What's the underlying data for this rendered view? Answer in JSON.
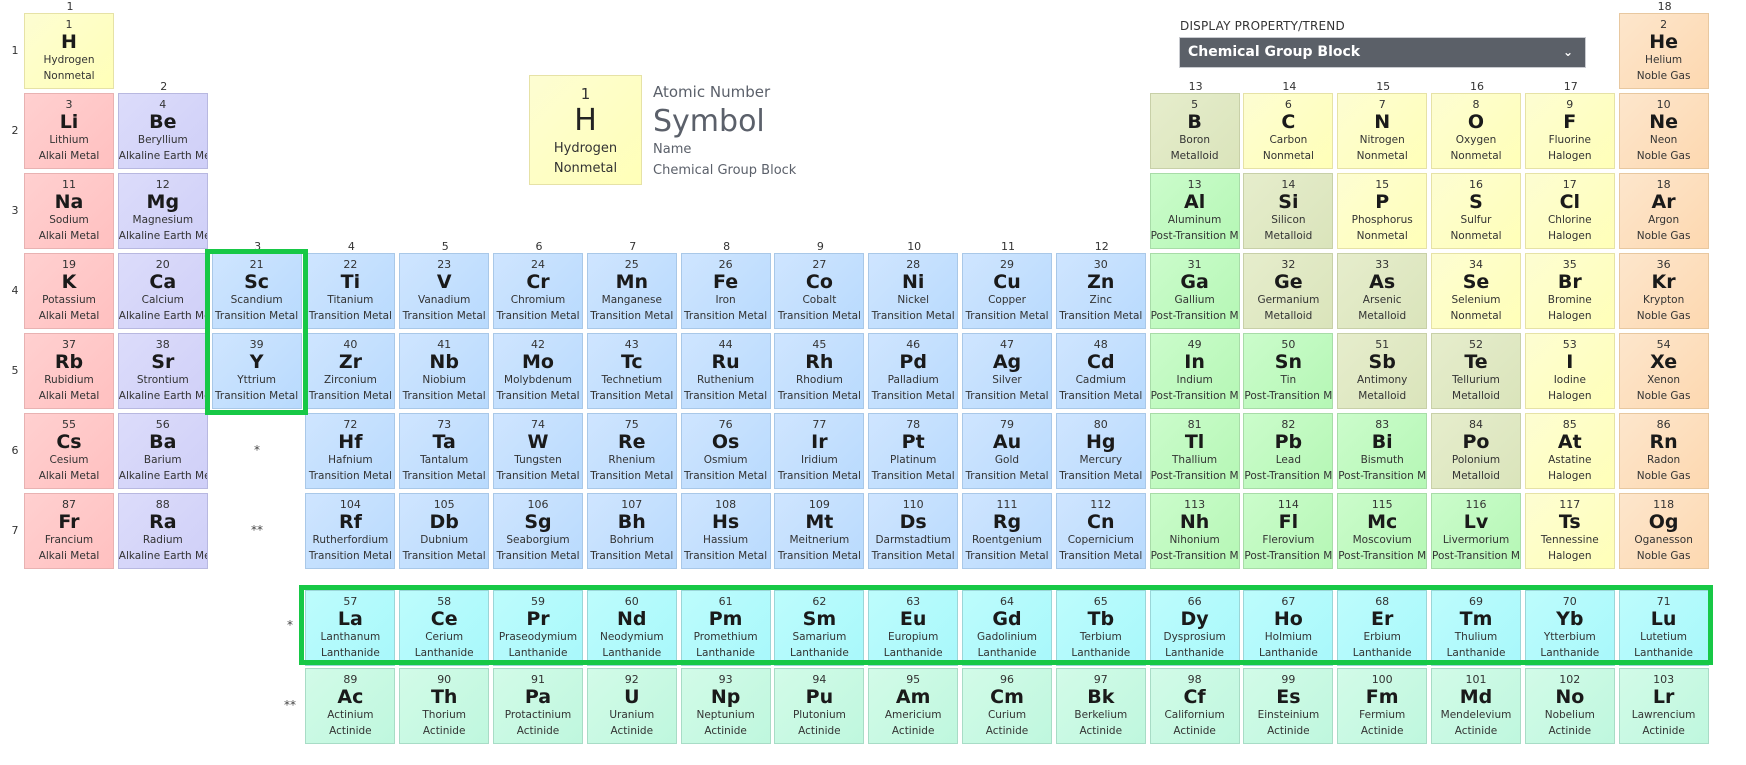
{
  "legend": {
    "atomic_number": "1",
    "symbol": "H",
    "name": "Hydrogen",
    "category": "Nonmetal",
    "label_atomic_number": "Atomic Number",
    "label_symbol": "Symbol",
    "label_name": "Name",
    "label_category": "Chemical Group Block"
  },
  "display_property": {
    "label": "DISPLAY PROPERTY/TREND",
    "selected": "Chemical Group Block",
    "chevron_icon": "chevron-down-icon"
  },
  "group_labels": [
    "1",
    "2",
    "3",
    "4",
    "5",
    "6",
    "7",
    "8",
    "9",
    "10",
    "11",
    "12",
    "13",
    "14",
    "15",
    "16",
    "17",
    "18"
  ],
  "period_labels": [
    "1",
    "2",
    "3",
    "4",
    "5",
    "6",
    "7"
  ],
  "markers": {
    "lanthanide": "*",
    "actinide": "**"
  },
  "highlight_color": "#17c846",
  "highlighted": [
    "Group 3 (Sc, Y)",
    "Lanthanide series"
  ],
  "elements": [
    {
      "n": "1",
      "s": "H",
      "name": "Hydrogen",
      "cat": "Nonmetal",
      "g": 1,
      "p": 1
    },
    {
      "n": "2",
      "s": "He",
      "name": "Helium",
      "cat": "Noble Gas",
      "g": 18,
      "p": 1
    },
    {
      "n": "3",
      "s": "Li",
      "name": "Lithium",
      "cat": "Alkali Metal",
      "g": 1,
      "p": 2
    },
    {
      "n": "4",
      "s": "Be",
      "name": "Beryllium",
      "cat": "Alkaline Earth Metal",
      "g": 2,
      "p": 2
    },
    {
      "n": "5",
      "s": "B",
      "name": "Boron",
      "cat": "Metalloid",
      "g": 13,
      "p": 2
    },
    {
      "n": "6",
      "s": "C",
      "name": "Carbon",
      "cat": "Nonmetal",
      "g": 14,
      "p": 2
    },
    {
      "n": "7",
      "s": "N",
      "name": "Nitrogen",
      "cat": "Nonmetal",
      "g": 15,
      "p": 2
    },
    {
      "n": "8",
      "s": "O",
      "name": "Oxygen",
      "cat": "Nonmetal",
      "g": 16,
      "p": 2
    },
    {
      "n": "9",
      "s": "F",
      "name": "Fluorine",
      "cat": "Halogen",
      "g": 17,
      "p": 2
    },
    {
      "n": "10",
      "s": "Ne",
      "name": "Neon",
      "cat": "Noble Gas",
      "g": 18,
      "p": 2
    },
    {
      "n": "11",
      "s": "Na",
      "name": "Sodium",
      "cat": "Alkali Metal",
      "g": 1,
      "p": 3
    },
    {
      "n": "12",
      "s": "Mg",
      "name": "Magnesium",
      "cat": "Alkaline Earth Metal",
      "g": 2,
      "p": 3
    },
    {
      "n": "13",
      "s": "Al",
      "name": "Aluminum",
      "cat": "Post-Transition Metal",
      "g": 13,
      "p": 3
    },
    {
      "n": "14",
      "s": "Si",
      "name": "Silicon",
      "cat": "Metalloid",
      "g": 14,
      "p": 3
    },
    {
      "n": "15",
      "s": "P",
      "name": "Phosphorus",
      "cat": "Nonmetal",
      "g": 15,
      "p": 3
    },
    {
      "n": "16",
      "s": "S",
      "name": "Sulfur",
      "cat": "Nonmetal",
      "g": 16,
      "p": 3
    },
    {
      "n": "17",
      "s": "Cl",
      "name": "Chlorine",
      "cat": "Halogen",
      "g": 17,
      "p": 3
    },
    {
      "n": "18",
      "s": "Ar",
      "name": "Argon",
      "cat": "Noble Gas",
      "g": 18,
      "p": 3
    },
    {
      "n": "19",
      "s": "K",
      "name": "Potassium",
      "cat": "Alkali Metal",
      "g": 1,
      "p": 4
    },
    {
      "n": "20",
      "s": "Ca",
      "name": "Calcium",
      "cat": "Alkaline Earth Metal",
      "g": 2,
      "p": 4
    },
    {
      "n": "21",
      "s": "Sc",
      "name": "Scandium",
      "cat": "Transition Metal",
      "g": 3,
      "p": 4
    },
    {
      "n": "22",
      "s": "Ti",
      "name": "Titanium",
      "cat": "Transition Metal",
      "g": 4,
      "p": 4
    },
    {
      "n": "23",
      "s": "V",
      "name": "Vanadium",
      "cat": "Transition Metal",
      "g": 5,
      "p": 4
    },
    {
      "n": "24",
      "s": "Cr",
      "name": "Chromium",
      "cat": "Transition Metal",
      "g": 6,
      "p": 4
    },
    {
      "n": "25",
      "s": "Mn",
      "name": "Manganese",
      "cat": "Transition Metal",
      "g": 7,
      "p": 4
    },
    {
      "n": "26",
      "s": "Fe",
      "name": "Iron",
      "cat": "Transition Metal",
      "g": 8,
      "p": 4
    },
    {
      "n": "27",
      "s": "Co",
      "name": "Cobalt",
      "cat": "Transition Metal",
      "g": 9,
      "p": 4
    },
    {
      "n": "28",
      "s": "Ni",
      "name": "Nickel",
      "cat": "Transition Metal",
      "g": 10,
      "p": 4
    },
    {
      "n": "29",
      "s": "Cu",
      "name": "Copper",
      "cat": "Transition Metal",
      "g": 11,
      "p": 4
    },
    {
      "n": "30",
      "s": "Zn",
      "name": "Zinc",
      "cat": "Transition Metal",
      "g": 12,
      "p": 4
    },
    {
      "n": "31",
      "s": "Ga",
      "name": "Gallium",
      "cat": "Post-Transition Metal",
      "g": 13,
      "p": 4
    },
    {
      "n": "32",
      "s": "Ge",
      "name": "Germanium",
      "cat": "Metalloid",
      "g": 14,
      "p": 4
    },
    {
      "n": "33",
      "s": "As",
      "name": "Arsenic",
      "cat": "Metalloid",
      "g": 15,
      "p": 4
    },
    {
      "n": "34",
      "s": "Se",
      "name": "Selenium",
      "cat": "Nonmetal",
      "g": 16,
      "p": 4
    },
    {
      "n": "35",
      "s": "Br",
      "name": "Bromine",
      "cat": "Halogen",
      "g": 17,
      "p": 4
    },
    {
      "n": "36",
      "s": "Kr",
      "name": "Krypton",
      "cat": "Noble Gas",
      "g": 18,
      "p": 4
    },
    {
      "n": "37",
      "s": "Rb",
      "name": "Rubidium",
      "cat": "Alkali Metal",
      "g": 1,
      "p": 5
    },
    {
      "n": "38",
      "s": "Sr",
      "name": "Strontium",
      "cat": "Alkaline Earth Metal",
      "g": 2,
      "p": 5
    },
    {
      "n": "39",
      "s": "Y",
      "name": "Yttrium",
      "cat": "Transition Metal",
      "g": 3,
      "p": 5
    },
    {
      "n": "40",
      "s": "Zr",
      "name": "Zirconium",
      "cat": "Transition Metal",
      "g": 4,
      "p": 5
    },
    {
      "n": "41",
      "s": "Nb",
      "name": "Niobium",
      "cat": "Transition Metal",
      "g": 5,
      "p": 5
    },
    {
      "n": "42",
      "s": "Mo",
      "name": "Molybdenum",
      "cat": "Transition Metal",
      "g": 6,
      "p": 5
    },
    {
      "n": "43",
      "s": "Tc",
      "name": "Technetium",
      "cat": "Transition Metal",
      "g": 7,
      "p": 5
    },
    {
      "n": "44",
      "s": "Ru",
      "name": "Ruthenium",
      "cat": "Transition Metal",
      "g": 8,
      "p": 5
    },
    {
      "n": "45",
      "s": "Rh",
      "name": "Rhodium",
      "cat": "Transition Metal",
      "g": 9,
      "p": 5
    },
    {
      "n": "46",
      "s": "Pd",
      "name": "Palladium",
      "cat": "Transition Metal",
      "g": 10,
      "p": 5
    },
    {
      "n": "47",
      "s": "Ag",
      "name": "Silver",
      "cat": "Transition Metal",
      "g": 11,
      "p": 5
    },
    {
      "n": "48",
      "s": "Cd",
      "name": "Cadmium",
      "cat": "Transition Metal",
      "g": 12,
      "p": 5
    },
    {
      "n": "49",
      "s": "In",
      "name": "Indium",
      "cat": "Post-Transition Metal",
      "g": 13,
      "p": 5
    },
    {
      "n": "50",
      "s": "Sn",
      "name": "Tin",
      "cat": "Post-Transition Metal",
      "g": 14,
      "p": 5
    },
    {
      "n": "51",
      "s": "Sb",
      "name": "Antimony",
      "cat": "Metalloid",
      "g": 15,
      "p": 5
    },
    {
      "n": "52",
      "s": "Te",
      "name": "Tellurium",
      "cat": "Metalloid",
      "g": 16,
      "p": 5
    },
    {
      "n": "53",
      "s": "I",
      "name": "Iodine",
      "cat": "Halogen",
      "g": 17,
      "p": 5
    },
    {
      "n": "54",
      "s": "Xe",
      "name": "Xenon",
      "cat": "Noble Gas",
      "g": 18,
      "p": 5
    },
    {
      "n": "55",
      "s": "Cs",
      "name": "Cesium",
      "cat": "Alkali Metal",
      "g": 1,
      "p": 6
    },
    {
      "n": "56",
      "s": "Ba",
      "name": "Barium",
      "cat": "Alkaline Earth Metal",
      "g": 2,
      "p": 6
    },
    {
      "n": "72",
      "s": "Hf",
      "name": "Hafnium",
      "cat": "Transition Metal",
      "g": 4,
      "p": 6
    },
    {
      "n": "73",
      "s": "Ta",
      "name": "Tantalum",
      "cat": "Transition Metal",
      "g": 5,
      "p": 6
    },
    {
      "n": "74",
      "s": "W",
      "name": "Tungsten",
      "cat": "Transition Metal",
      "g": 6,
      "p": 6
    },
    {
      "n": "75",
      "s": "Re",
      "name": "Rhenium",
      "cat": "Transition Metal",
      "g": 7,
      "p": 6
    },
    {
      "n": "76",
      "s": "Os",
      "name": "Osmium",
      "cat": "Transition Metal",
      "g": 8,
      "p": 6
    },
    {
      "n": "77",
      "s": "Ir",
      "name": "Iridium",
      "cat": "Transition Metal",
      "g": 9,
      "p": 6
    },
    {
      "n": "78",
      "s": "Pt",
      "name": "Platinum",
      "cat": "Transition Metal",
      "g": 10,
      "p": 6
    },
    {
      "n": "79",
      "s": "Au",
      "name": "Gold",
      "cat": "Transition Metal",
      "g": 11,
      "p": 6
    },
    {
      "n": "80",
      "s": "Hg",
      "name": "Mercury",
      "cat": "Transition Metal",
      "g": 12,
      "p": 6
    },
    {
      "n": "81",
      "s": "Tl",
      "name": "Thallium",
      "cat": "Post-Transition Metal",
      "g": 13,
      "p": 6
    },
    {
      "n": "82",
      "s": "Pb",
      "name": "Lead",
      "cat": "Post-Transition Metal",
      "g": 14,
      "p": 6
    },
    {
      "n": "83",
      "s": "Bi",
      "name": "Bismuth",
      "cat": "Post-Transition Metal",
      "g": 15,
      "p": 6
    },
    {
      "n": "84",
      "s": "Po",
      "name": "Polonium",
      "cat": "Metalloid",
      "g": 16,
      "p": 6
    },
    {
      "n": "85",
      "s": "At",
      "name": "Astatine",
      "cat": "Halogen",
      "g": 17,
      "p": 6
    },
    {
      "n": "86",
      "s": "Rn",
      "name": "Radon",
      "cat": "Noble Gas",
      "g": 18,
      "p": 6
    },
    {
      "n": "87",
      "s": "Fr",
      "name": "Francium",
      "cat": "Alkali Metal",
      "g": 1,
      "p": 7
    },
    {
      "n": "88",
      "s": "Ra",
      "name": "Radium",
      "cat": "Alkaline Earth Metal",
      "g": 2,
      "p": 7
    },
    {
      "n": "104",
      "s": "Rf",
      "name": "Rutherfordium",
      "cat": "Transition Metal",
      "g": 4,
      "p": 7
    },
    {
      "n": "105",
      "s": "Db",
      "name": "Dubnium",
      "cat": "Transition Metal",
      "g": 5,
      "p": 7
    },
    {
      "n": "106",
      "s": "Sg",
      "name": "Seaborgium",
      "cat": "Transition Metal",
      "g": 6,
      "p": 7
    },
    {
      "n": "107",
      "s": "Bh",
      "name": "Bohrium",
      "cat": "Transition Metal",
      "g": 7,
      "p": 7
    },
    {
      "n": "108",
      "s": "Hs",
      "name": "Hassium",
      "cat": "Transition Metal",
      "g": 8,
      "p": 7
    },
    {
      "n": "109",
      "s": "Mt",
      "name": "Meitnerium",
      "cat": "Transition Metal",
      "g": 9,
      "p": 7
    },
    {
      "n": "110",
      "s": "Ds",
      "name": "Darmstadtium",
      "cat": "Transition Metal",
      "g": 10,
      "p": 7
    },
    {
      "n": "111",
      "s": "Rg",
      "name": "Roentgenium",
      "cat": "Transition Metal",
      "g": 11,
      "p": 7
    },
    {
      "n": "112",
      "s": "Cn",
      "name": "Copernicium",
      "cat": "Transition Metal",
      "g": 12,
      "p": 7
    },
    {
      "n": "113",
      "s": "Nh",
      "name": "Nihonium",
      "cat": "Post-Transition Metal",
      "g": 13,
      "p": 7
    },
    {
      "n": "114",
      "s": "Fl",
      "name": "Flerovium",
      "cat": "Post-Transition Metal",
      "g": 14,
      "p": 7
    },
    {
      "n": "115",
      "s": "Mc",
      "name": "Moscovium",
      "cat": "Post-Transition Metal",
      "g": 15,
      "p": 7
    },
    {
      "n": "116",
      "s": "Lv",
      "name": "Livermorium",
      "cat": "Post-Transition Metal",
      "g": 16,
      "p": 7
    },
    {
      "n": "117",
      "s": "Ts",
      "name": "Tennessine",
      "cat": "Halogen",
      "g": 17,
      "p": 7
    },
    {
      "n": "118",
      "s": "Og",
      "name": "Oganesson",
      "cat": "Noble Gas",
      "g": 18,
      "p": 7
    },
    {
      "n": "57",
      "s": "La",
      "name": "Lanthanum",
      "cat": "Lanthanide",
      "g": 4,
      "p": 8
    },
    {
      "n": "58",
      "s": "Ce",
      "name": "Cerium",
      "cat": "Lanthanide",
      "g": 5,
      "p": 8
    },
    {
      "n": "59",
      "s": "Pr",
      "name": "Praseodymium",
      "cat": "Lanthanide",
      "g": 6,
      "p": 8
    },
    {
      "n": "60",
      "s": "Nd",
      "name": "Neodymium",
      "cat": "Lanthanide",
      "g": 7,
      "p": 8
    },
    {
      "n": "61",
      "s": "Pm",
      "name": "Promethium",
      "cat": "Lanthanide",
      "g": 8,
      "p": 8
    },
    {
      "n": "62",
      "s": "Sm",
      "name": "Samarium",
      "cat": "Lanthanide",
      "g": 9,
      "p": 8
    },
    {
      "n": "63",
      "s": "Eu",
      "name": "Europium",
      "cat": "Lanthanide",
      "g": 10,
      "p": 8
    },
    {
      "n": "64",
      "s": "Gd",
      "name": "Gadolinium",
      "cat": "Lanthanide",
      "g": 11,
      "p": 8
    },
    {
      "n": "65",
      "s": "Tb",
      "name": "Terbium",
      "cat": "Lanthanide",
      "g": 12,
      "p": 8
    },
    {
      "n": "66",
      "s": "Dy",
      "name": "Dysprosium",
      "cat": "Lanthanide",
      "g": 13,
      "p": 8
    },
    {
      "n": "67",
      "s": "Ho",
      "name": "Holmium",
      "cat": "Lanthanide",
      "g": 14,
      "p": 8
    },
    {
      "n": "68",
      "s": "Er",
      "name": "Erbium",
      "cat": "Lanthanide",
      "g": 15,
      "p": 8
    },
    {
      "n": "69",
      "s": "Tm",
      "name": "Thulium",
      "cat": "Lanthanide",
      "g": 16,
      "p": 8
    },
    {
      "n": "70",
      "s": "Yb",
      "name": "Ytterbium",
      "cat": "Lanthanide",
      "g": 17,
      "p": 8
    },
    {
      "n": "71",
      "s": "Lu",
      "name": "Lutetium",
      "cat": "Lanthanide",
      "g": 18,
      "p": 8
    },
    {
      "n": "89",
      "s": "Ac",
      "name": "Actinium",
      "cat": "Actinide",
      "g": 4,
      "p": 9
    },
    {
      "n": "90",
      "s": "Th",
      "name": "Thorium",
      "cat": "Actinide",
      "g": 5,
      "p": 9
    },
    {
      "n": "91",
      "s": "Pa",
      "name": "Protactinium",
      "cat": "Actinide",
      "g": 6,
      "p": 9
    },
    {
      "n": "92",
      "s": "U",
      "name": "Uranium",
      "cat": "Actinide",
      "g": 7,
      "p": 9
    },
    {
      "n": "93",
      "s": "Np",
      "name": "Neptunium",
      "cat": "Actinide",
      "g": 8,
      "p": 9
    },
    {
      "n": "94",
      "s": "Pu",
      "name": "Plutonium",
      "cat": "Actinide",
      "g": 9,
      "p": 9
    },
    {
      "n": "95",
      "s": "Am",
      "name": "Americium",
      "cat": "Actinide",
      "g": 10,
      "p": 9
    },
    {
      "n": "96",
      "s": "Cm",
      "name": "Curium",
      "cat": "Actinide",
      "g": 11,
      "p": 9
    },
    {
      "n": "97",
      "s": "Bk",
      "name": "Berkelium",
      "cat": "Actinide",
      "g": 12,
      "p": 9
    },
    {
      "n": "98",
      "s": "Cf",
      "name": "Californium",
      "cat": "Actinide",
      "g": 13,
      "p": 9
    },
    {
      "n": "99",
      "s": "Es",
      "name": "Einsteinium",
      "cat": "Actinide",
      "g": 14,
      "p": 9
    },
    {
      "n": "100",
      "s": "Fm",
      "name": "Fermium",
      "cat": "Actinide",
      "g": 15,
      "p": 9
    },
    {
      "n": "101",
      "s": "Md",
      "name": "Mendelevium",
      "cat": "Actinide",
      "g": 16,
      "p": 9
    },
    {
      "n": "102",
      "s": "No",
      "name": "Nobelium",
      "cat": "Actinide",
      "g": 17,
      "p": 9
    },
    {
      "n": "103",
      "s": "Lr",
      "name": "Lawrencium",
      "cat": "Actinide",
      "g": 18,
      "p": 9
    }
  ]
}
